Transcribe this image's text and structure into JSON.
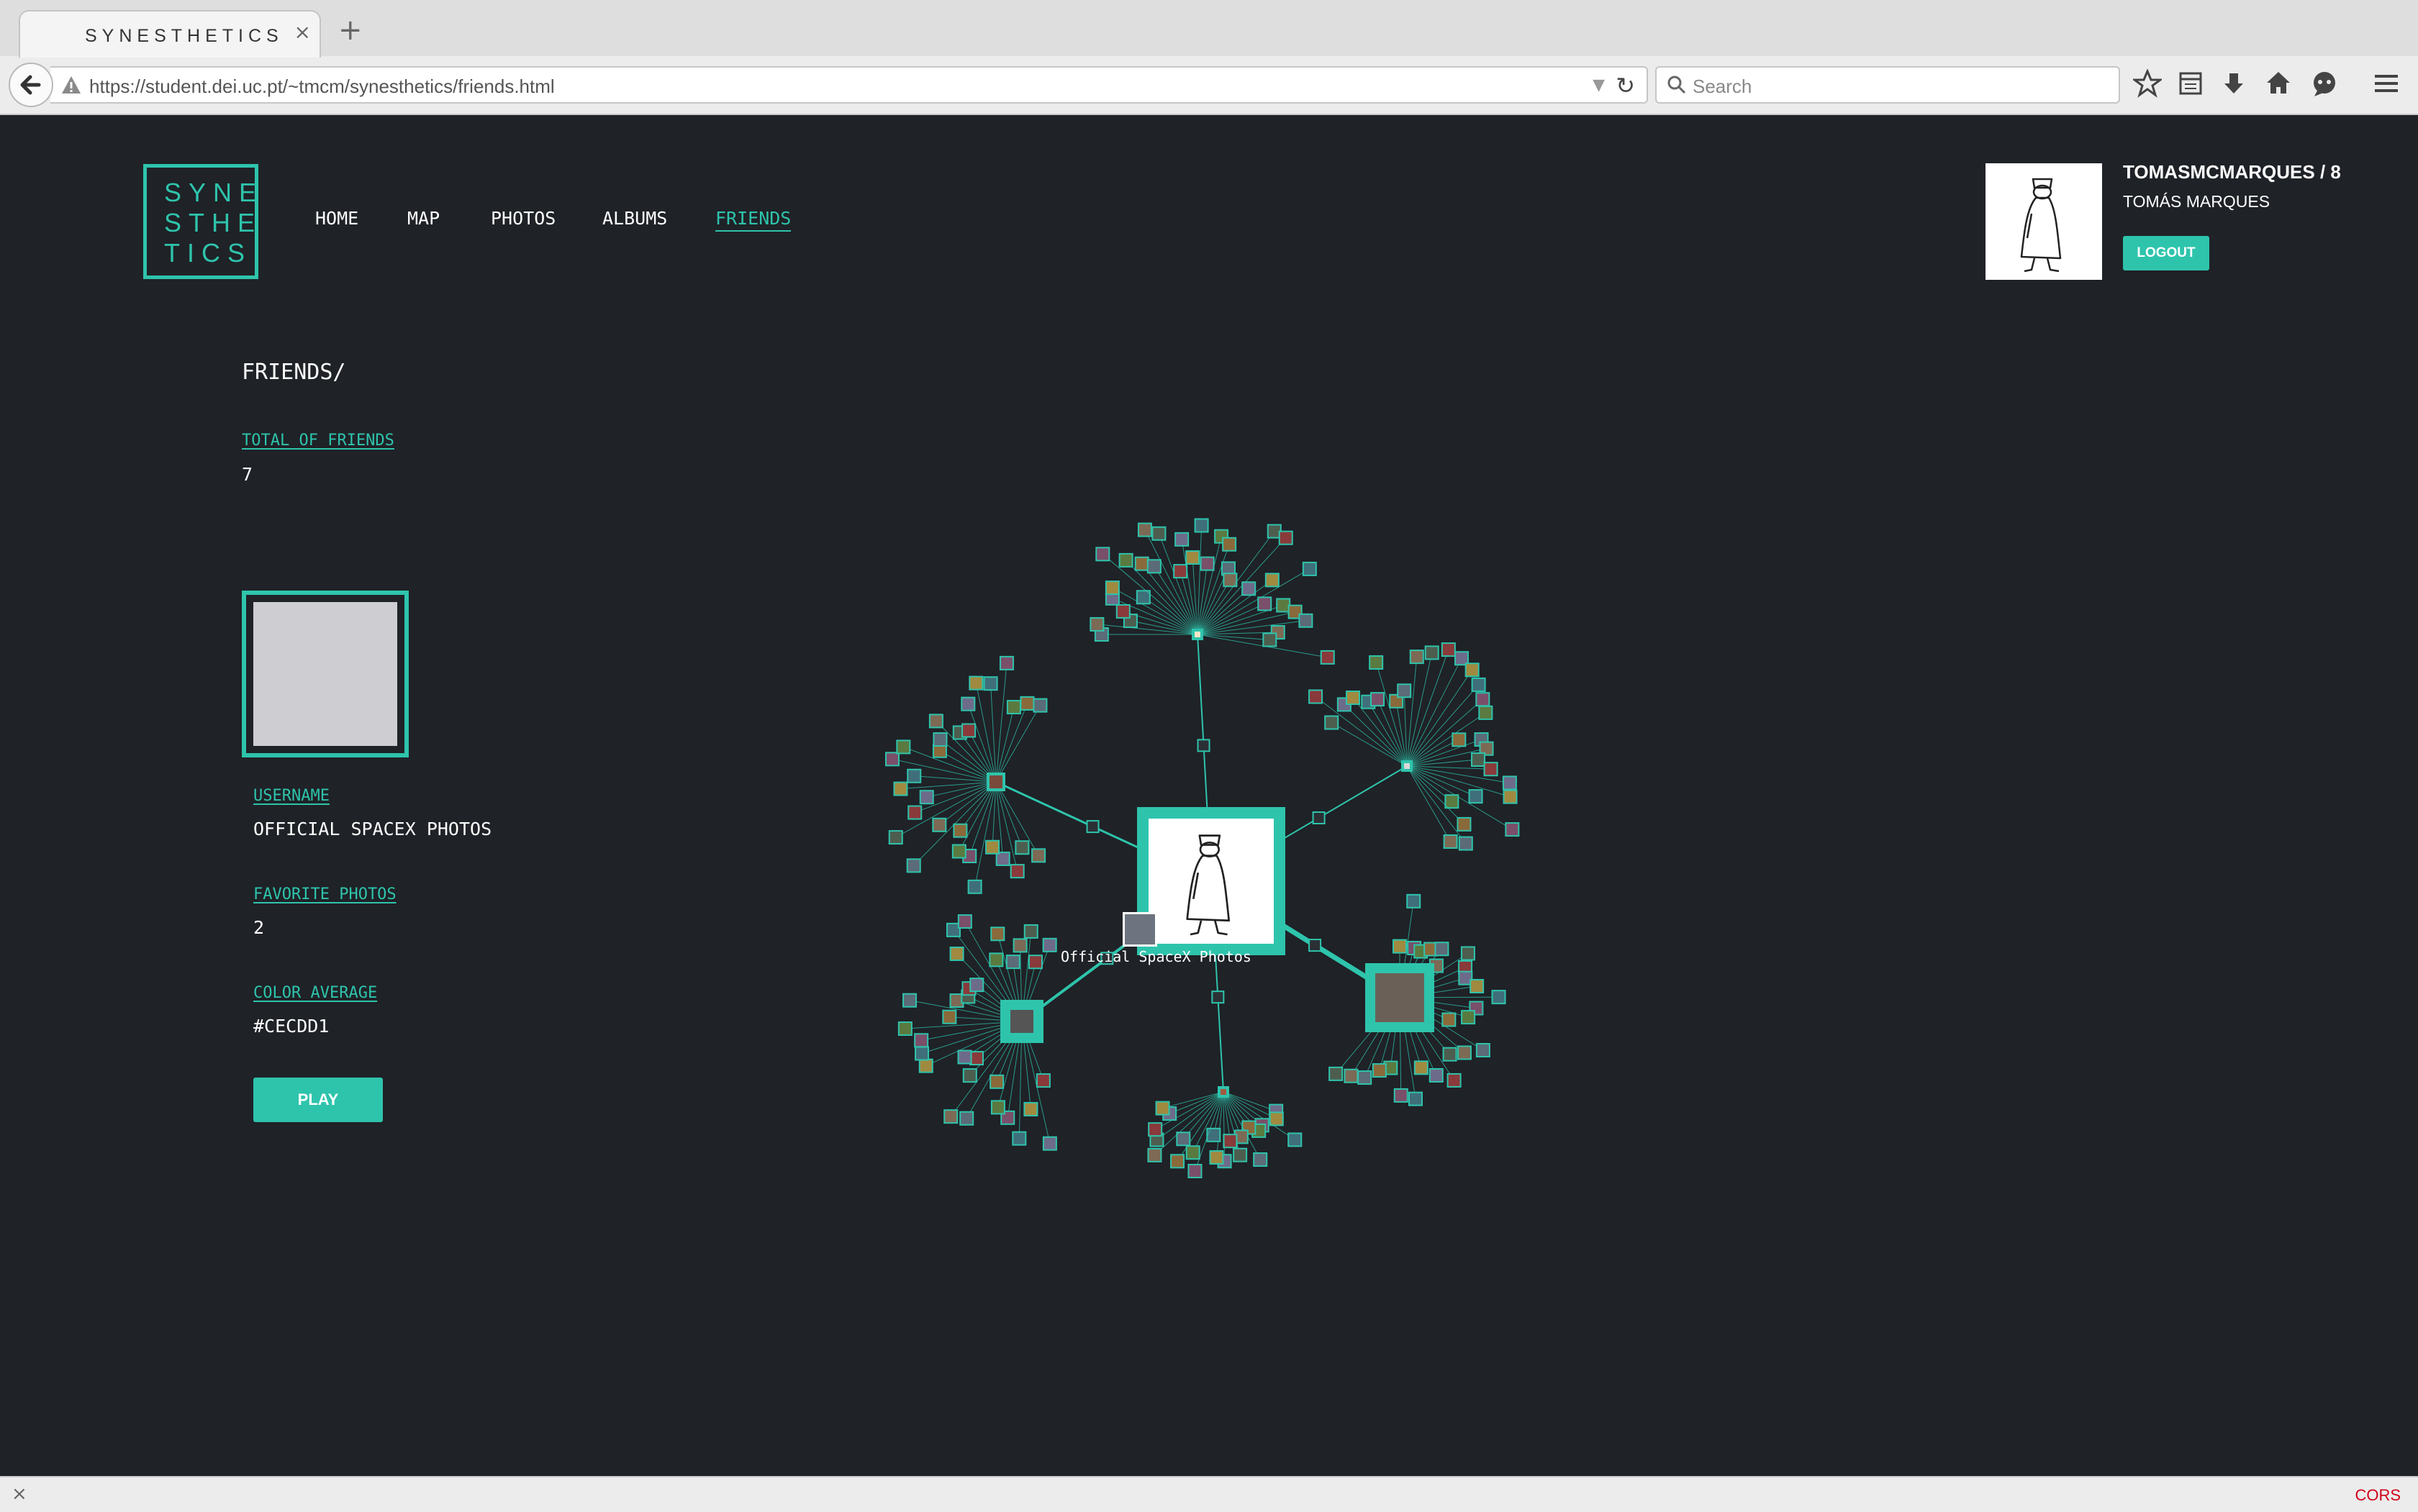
{
  "browser": {
    "tab_title": "SYNESTHETICS",
    "tab_close": "×",
    "new_tab": "+",
    "url": "https://student.dei.uc.pt/~tmcm/synesthetics/friends.html",
    "search_placeholder": "Search",
    "status_close": "×",
    "status_right": "CORS"
  },
  "site": {
    "logo_lines": [
      "SYNE",
      "STHE",
      "TICS"
    ],
    "nav": [
      "HOME",
      "MAP",
      "PHOTOS",
      "ALBUMS",
      "FRIENDS"
    ],
    "active_nav": "FRIENDS",
    "accent_color": "#2ec4ac",
    "background_color": "#1f2227"
  },
  "user": {
    "username_line": "TOMASMCMARQUES / 8",
    "full_name": "TOMÁS MARQUES",
    "logout_label": "LOGOUT"
  },
  "friends_page": {
    "heading": "FRIENDS/",
    "total_label": "TOTAL OF FRIENDS",
    "total_value": "7",
    "selected": {
      "username_label": "USERNAME",
      "username": "OFFICIAL SPACEX PHOTOS",
      "favorite_label": "FAVORITE PHOTOS",
      "favorite_value": "2",
      "color_label": "COLOR AVERAGE",
      "color_value": "#CECDD1",
      "play_label": "PLAY"
    }
  },
  "graph": {
    "tooltip": "Official SpaceX Photos",
    "friend_count": 6
  }
}
